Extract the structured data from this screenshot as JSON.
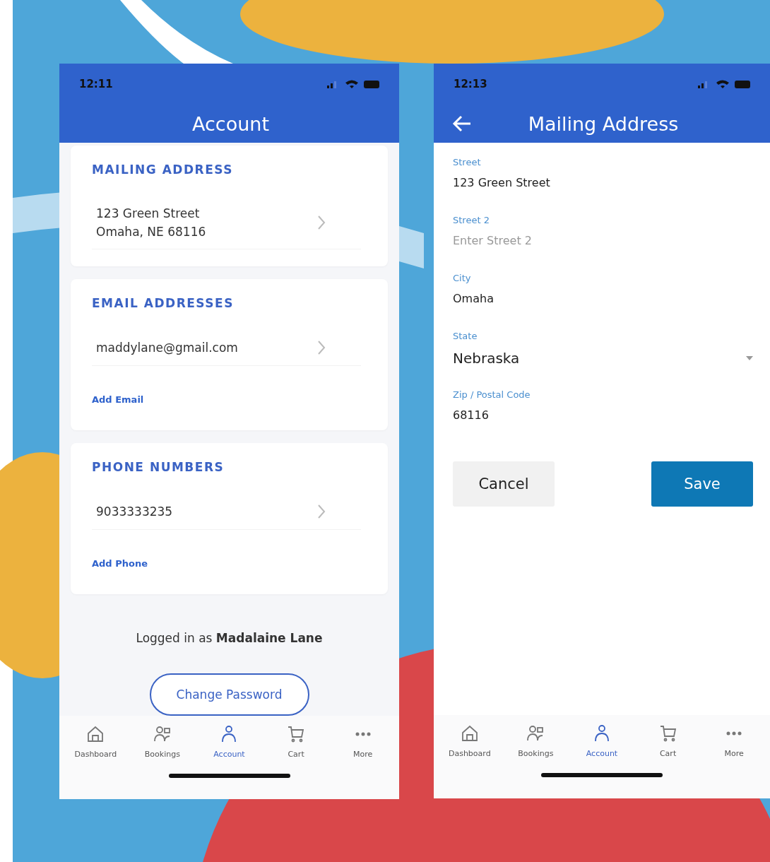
{
  "account_screen": {
    "status_time": "12:11",
    "title": "Account",
    "sections": [
      {
        "heading": "MAILING ADDRESS",
        "rows": [
          {
            "lines": [
              "123 Green Street",
              "Omaha, NE 68116"
            ]
          }
        ]
      },
      {
        "heading": "EMAIL ADDRESSES",
        "rows": [
          {
            "lines": [
              "maddylane@gmail.com"
            ]
          }
        ],
        "add_link": "Add Email"
      },
      {
        "heading": "PHONE NUMBERS",
        "rows": [
          {
            "lines": [
              "9033333235"
            ]
          }
        ],
        "add_link": "Add Phone"
      }
    ],
    "logged_in": "Logged in as **Madalaine Lane**",
    "change_password": "Change Password",
    "tabs": [
      {
        "label": "Dashboard",
        "selected": false
      },
      {
        "label": "Bookings",
        "selected": false
      },
      {
        "label": "Account",
        "selected": true
      },
      {
        "label": "Cart",
        "selected": false
      },
      {
        "label": "More",
        "selected": false
      }
    ]
  },
  "mailing_address_screen": {
    "status_time": "12:13",
    "title": "Mailing Address",
    "fields": [
      {
        "kind": "text",
        "label": "Street",
        "value": "123 Green Street"
      },
      {
        "kind": "text",
        "label": "Street 2",
        "placeholder": "Enter Street 2"
      },
      {
        "kind": "text",
        "label": "City",
        "value": "Omaha"
      },
      {
        "kind": "select",
        "label": "State",
        "value": "Nebraska"
      },
      {
        "kind": "text",
        "label": "Zip / Postal Code",
        "value": "68116"
      }
    ],
    "buttons": [
      {
        "kind": "secondary",
        "label": "Cancel"
      },
      {
        "kind": "primary",
        "label": "Save"
      }
    ],
    "tabs": [
      {
        "label": "Dashboard",
        "selected": false
      },
      {
        "label": "Bookings",
        "selected": false
      },
      {
        "label": "Account",
        "selected": true
      },
      {
        "label": "Cart",
        "selected": false
      },
      {
        "label": "More",
        "selected": false
      }
    ]
  }
}
